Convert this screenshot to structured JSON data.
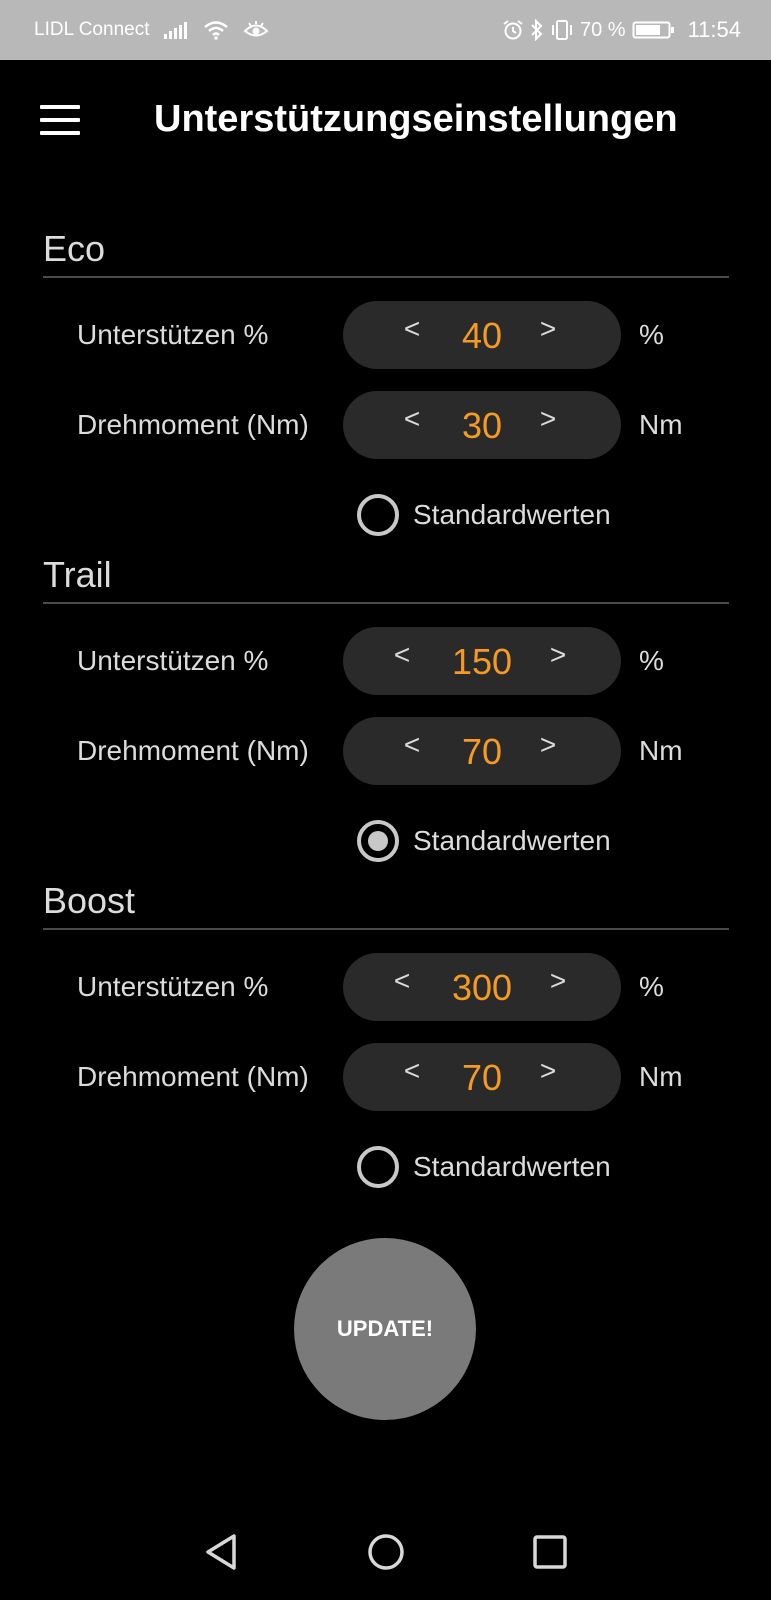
{
  "status_bar": {
    "carrier": "LIDL Connect",
    "battery_percent": "70 %",
    "time": "11:54"
  },
  "app_bar": {
    "title": "Unterstützungseinstellungen"
  },
  "sections": [
    {
      "title": "Eco",
      "assist_label": "Unterstützen %",
      "assist_value": "40",
      "assist_unit": "%",
      "torque_label": "Drehmoment (Nm)",
      "torque_value": "30",
      "torque_unit": "Nm",
      "defaults_label": "Standardwerten",
      "defaults_checked": false
    },
    {
      "title": "Trail",
      "assist_label": "Unterstützen %",
      "assist_value": "150",
      "assist_unit": "%",
      "torque_label": "Drehmoment (Nm)",
      "torque_value": "70",
      "torque_unit": "Nm",
      "defaults_label": "Standardwerten",
      "defaults_checked": false
    },
    {
      "title": "Boost",
      "assist_label": "Unterstützen %",
      "assist_value": "300",
      "assist_unit": "%",
      "torque_label": "Drehmoment (Nm)",
      "torque_value": "70",
      "torque_unit": "Nm",
      "defaults_label": "Standardwerten",
      "defaults_checked": true
    }
  ],
  "stepper": {
    "decrement_label": "<",
    "increment_label": ">"
  },
  "update_button": {
    "label": "UPDATE!"
  },
  "colors": {
    "value": "#f59a23",
    "stepper_bg": "#2a2a2a",
    "update_bg": "#7a7a7a",
    "status_bar_bg": "#b8b8b8"
  }
}
